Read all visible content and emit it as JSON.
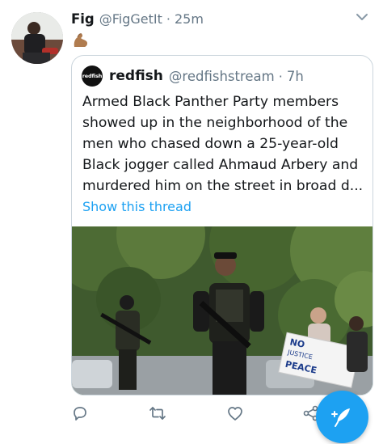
{
  "tweet": {
    "author_name": "Fig",
    "author_handle": "@FigGetIt",
    "separator": "·",
    "time": "25m",
    "emoji": "flexed-biceps-emoji"
  },
  "quoted_tweet": {
    "author_name": "redfish",
    "author_handle": "@redfishstream",
    "separator": "·",
    "time": "7h",
    "logo_text": "redfish",
    "text_lines": [
      "Armed Black Panther Party members",
      "showed up in the neighborhood of the",
      "men who chased down a 25-year-old",
      "Black jogger called Ahmaud Arbery and",
      "murdered him on the street in broad d..."
    ],
    "show_thread_label": "Show this thread",
    "photo_sign": {
      "line1": "NO",
      "line2": "JUSTICE",
      "line3": "PEACE"
    }
  },
  "actions": {
    "icons": [
      "reply-icon",
      "retweet-icon",
      "like-icon",
      "share-icon"
    ]
  },
  "fab": {
    "icon": "compose-tweet-icon"
  },
  "colors": {
    "accent": "#1da1f2",
    "text": "#14171a",
    "muted": "#657786",
    "border": "#ccd6dd"
  }
}
